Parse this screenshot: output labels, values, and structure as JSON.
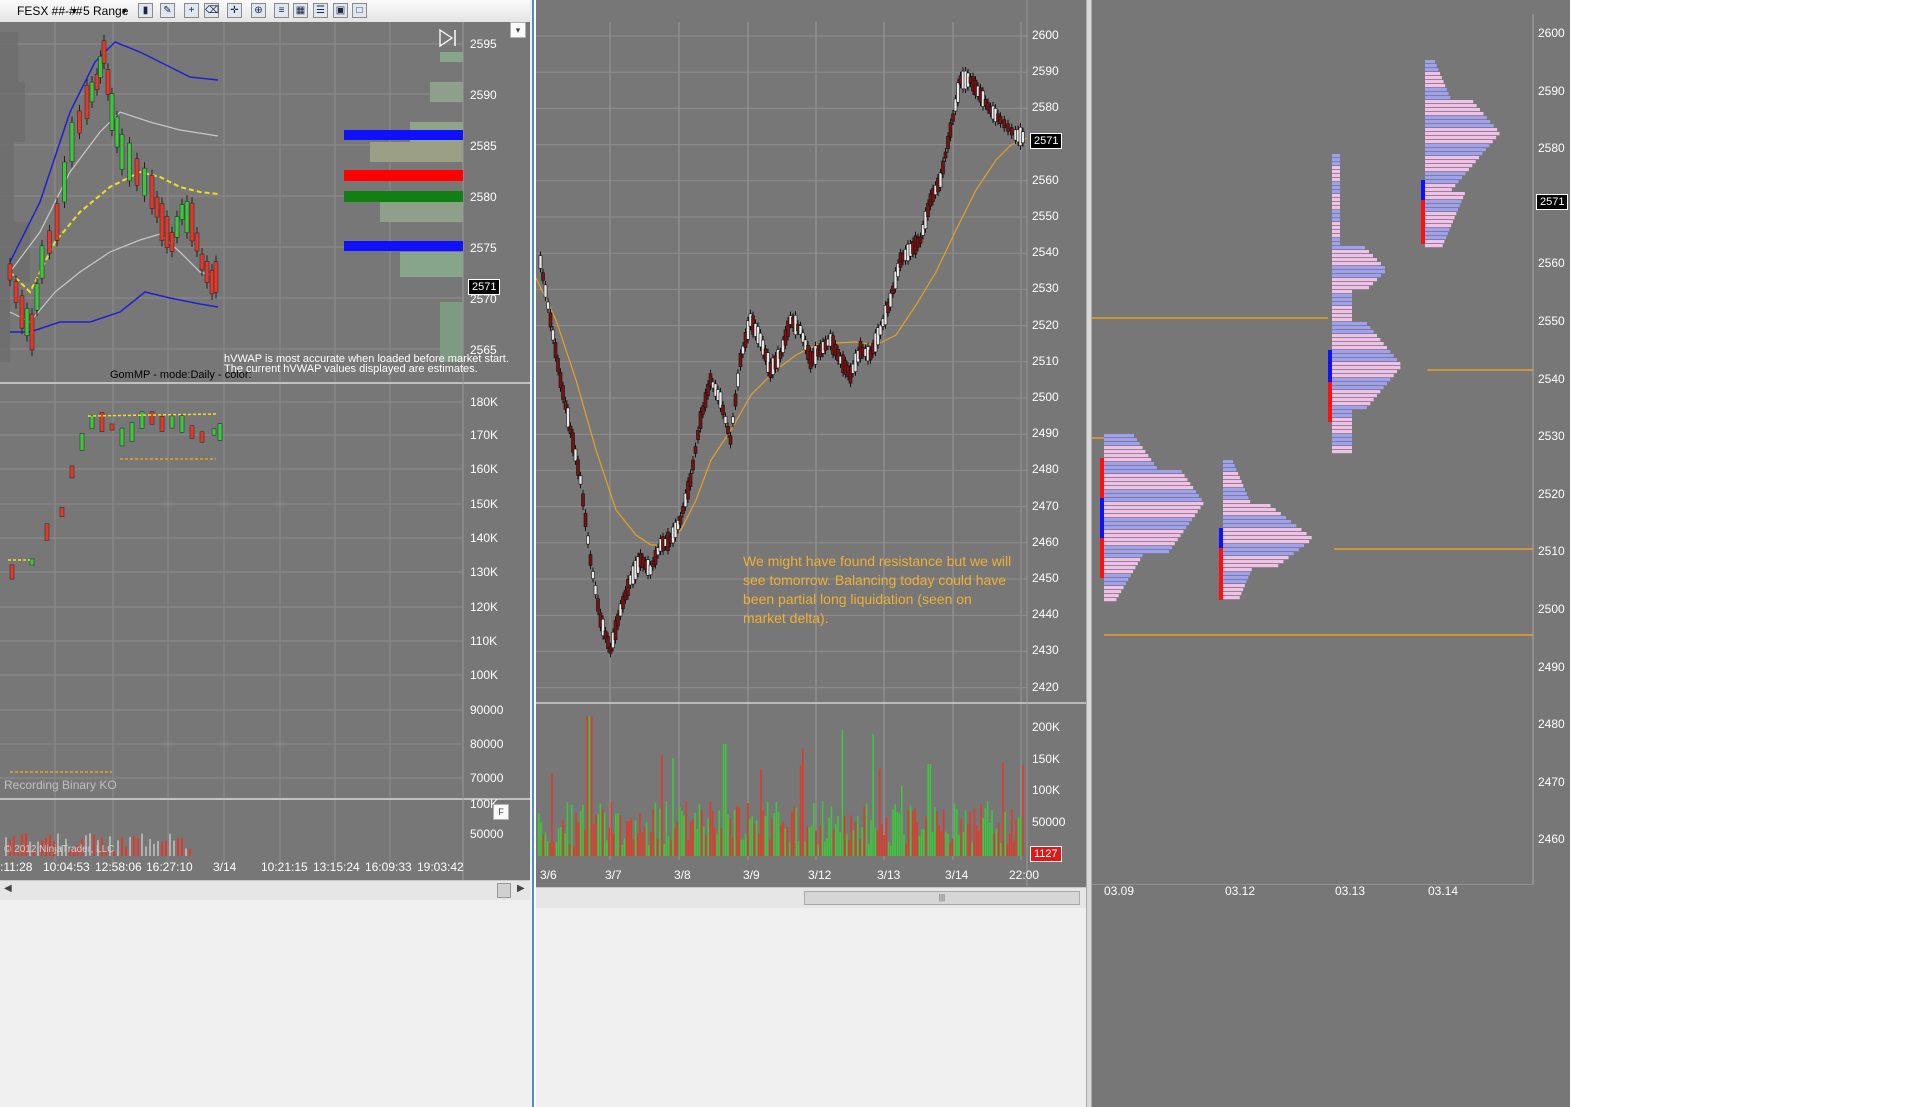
{
  "toolbar": {
    "instrument": "FESX ##-##",
    "interval": "5 Range"
  },
  "left_chart": {
    "price_labels": [
      "2595",
      "2590",
      "2585",
      "2580",
      "2575",
      "2570",
      "2565"
    ],
    "price_tag": "2571",
    "volume_labels": [
      "180K",
      "170K",
      "160K",
      "150K",
      "140K",
      "130K",
      "120K",
      "110K",
      "100K",
      "90000",
      "80000",
      "70000"
    ],
    "lower_volume_labels": [
      "100K",
      "50000"
    ],
    "notice_line1": "hVWAP is most accurate when loaded before market start.",
    "notice_line2": "The current hVWAP values displayed are estimates.",
    "gommp_text": "GomMP - mode:Daily - color:",
    "recording_text": "Recording Binary KO",
    "copyright": "© 2012 NinjaTrader, LLC",
    "time_labels": [
      ":11:28",
      "10:04:53",
      "12:58:06",
      "16:27:10",
      "3/14",
      "10:21:15",
      "13:15:24",
      "16:09:33",
      "19:03:42"
    ],
    "f_button": "F"
  },
  "middle_chart": {
    "price_labels": [
      "2600",
      "2590",
      "2580",
      "2570",
      "2560",
      "2550",
      "2540",
      "2530",
      "2520",
      "2510",
      "2500",
      "2490",
      "2480",
      "2470",
      "2460",
      "2450",
      "2440",
      "2430",
      "2420"
    ],
    "price_tag": "2571",
    "volume_labels": [
      "200K",
      "150K",
      "100K",
      "50000"
    ],
    "volume_tag": "1127",
    "date_labels": [
      "3/6",
      "3/7",
      "3/8",
      "3/9",
      "3/12",
      "3/13",
      "3/14",
      "22:00"
    ],
    "annotation": "We might have found resistance but we will see tomorrow. Balancing today could have been partial long liquidation (seen on market delta)."
  },
  "right_chart": {
    "price_labels": [
      "2600",
      "2590",
      "2580",
      "2570",
      "2560",
      "2550",
      "2540",
      "2530",
      "2520",
      "2510",
      "2500",
      "2490",
      "2480",
      "2470",
      "2460"
    ],
    "price_tag": "2571",
    "date_labels": [
      "03.09",
      "03.12",
      "03.13",
      "03.14"
    ]
  },
  "colors": {
    "chart_bg": "#777777",
    "bull": "#3cc83c",
    "bear": "#e03a2a",
    "orange": "#e8a020",
    "profile_pink": "#f0c0e8",
    "profile_blue": "#a0a0f0"
  }
}
